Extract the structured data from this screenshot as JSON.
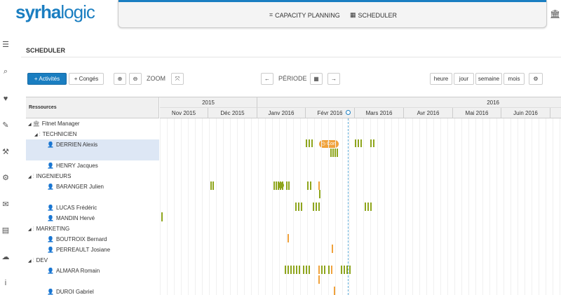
{
  "brand": {
    "part1": "syrha",
    "part2": "logic"
  },
  "topnav": {
    "capacity": "CAPACITY PLANNING",
    "scheduler": "SCHEDULER"
  },
  "page": {
    "title": "SCHEDULER"
  },
  "toolbar": {
    "activites": "+ Activités",
    "conges": "+ Congés",
    "zoom_label": "ZOOM",
    "periode_label": "PÉRIODE",
    "views": [
      "heure",
      "jour",
      "semaine",
      "mois"
    ]
  },
  "gantt": {
    "resources_header": "Ressources",
    "years": [
      "2015",
      "2016"
    ],
    "months": [
      "Nov 2015",
      "Déc 2015",
      "Janv 2016",
      "Févr 2016",
      "Mars 2016",
      "Avr 2016",
      "Mai 2016",
      "Juin 2016"
    ],
    "tree": [
      {
        "label": "Fitnet Manager",
        "type": "root"
      },
      {
        "label": "TECHNICIEN",
        "type": "group"
      },
      {
        "label": "DERRIEN Alexis",
        "type": "person"
      },
      {
        "label": "HENRY Jacques",
        "type": "person"
      },
      {
        "label": "INGENIEURS",
        "type": "group"
      },
      {
        "label": "BARANGER Julien",
        "type": "person"
      },
      {
        "label": "LUCAS Frédéric",
        "type": "person"
      },
      {
        "label": "MANDIN Hervé",
        "type": "person"
      },
      {
        "label": "MARKETING",
        "type": "group"
      },
      {
        "label": "BOUTROIX Bernard",
        "type": "person"
      },
      {
        "label": "PERREAULT Josiane",
        "type": "person"
      },
      {
        "label": "DEV",
        "type": "group"
      },
      {
        "label": "ALMARA Romain",
        "type": "person"
      },
      {
        "label": "DUROI Gabriel",
        "type": "person"
      }
    ],
    "event_pill": "Con",
    "colors": {
      "activity": "#8ea51c",
      "leave": "#f0a23c",
      "accent": "#1a7ec1"
    }
  }
}
